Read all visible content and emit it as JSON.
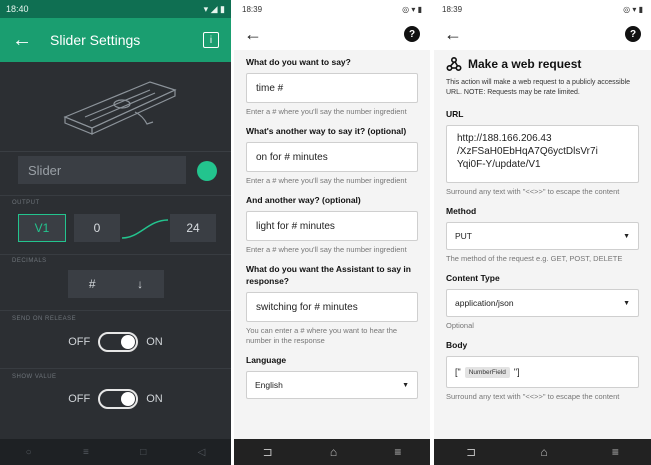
{
  "p1": {
    "status_time": "18:40",
    "title": "Slider Settings",
    "info_icon": "info-icon",
    "name_field": "Slider",
    "accent": "#23c48e",
    "output_label": "OUTPUT",
    "pin": "V1",
    "min": "0",
    "max": "24",
    "decimals_label": "DECIMALS",
    "decimals_value": "#",
    "send_label": "SEND ON RELEASE",
    "show_label": "SHOW VALUE",
    "off": "OFF",
    "on": "ON"
  },
  "p2": {
    "status_time": "18:39",
    "q1": "What do you want to say?",
    "v1": "time #",
    "hint1": "Enter a # where you'll say the number ingredient",
    "q2": "What's another way to say it? (optional)",
    "v2": "on for # minutes",
    "hint2": "Enter a # where you'll say the number ingredient",
    "q3": "And another way? (optional)",
    "v3": "light for # minutes",
    "hint3": "Enter a # where you'll say the number ingredient",
    "q4": "What do you want the Assistant to say in response?",
    "v4": "switching for # minutes",
    "hint4": "You can enter a # where you want to hear the number in the response",
    "lang_label": "Language",
    "lang_value": "English"
  },
  "p3": {
    "status_time": "18:39",
    "title": "Make a web request",
    "desc": "This action will make a web request to a publicly accessible URL. NOTE: Requests may be rate limited.",
    "url_label": "URL",
    "url_value": "http://188.166.206.43 /XzFSaH0EbHqA7Q6yctDlsVr7i Yqi0F-Y/update/V1",
    "url_hint": "Surround any text with \"<<>>\" to escape the content",
    "method_label": "Method",
    "method_value": "PUT",
    "method_hint": "The method of the request e.g. GET, POST, DELETE",
    "ctype_label": "Content Type",
    "ctype_value": "application/json",
    "ctype_hint": "Optional",
    "body_label": "Body",
    "body_open": "[\"",
    "body_chip": "NumberField",
    "body_close": "\"]",
    "body_hint": "Surround any text with \"<<>>\" to escape the content"
  }
}
